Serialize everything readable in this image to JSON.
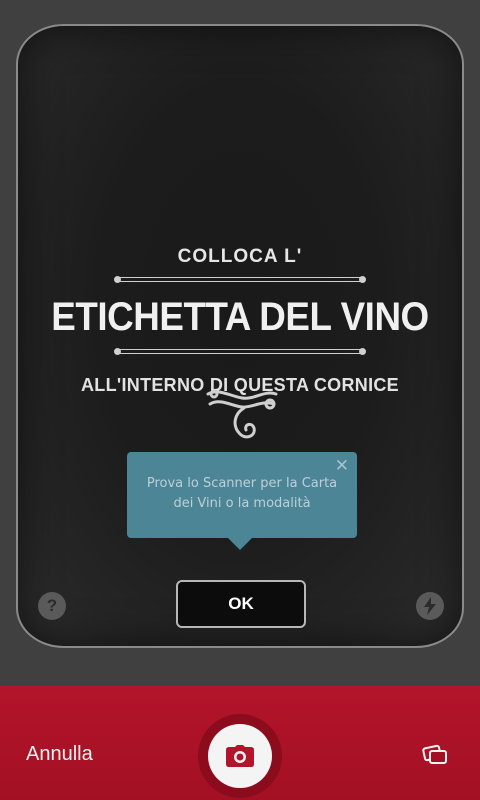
{
  "headline": {
    "line1": "COLLOCA L'",
    "line2": "ETICHETTA DEL VINO",
    "line3": "ALL'INTERNO DI QUESTA CORNICE"
  },
  "tooltip": {
    "text": "Prova lo Scanner per la Carta dei Vini o la modalità",
    "close_glyph": "✕"
  },
  "ok_button": {
    "label": "OK"
  },
  "help_button": {
    "glyph": "?"
  },
  "bottom_bar": {
    "cancel_label": "Annulla"
  },
  "icons": {
    "help": "help-icon",
    "flash": "flash-icon",
    "camera": "camera-icon",
    "cards": "cards-icon"
  },
  "colors": {
    "accent_red": "#b3142a",
    "tooltip_blue": "#4b8596"
  }
}
